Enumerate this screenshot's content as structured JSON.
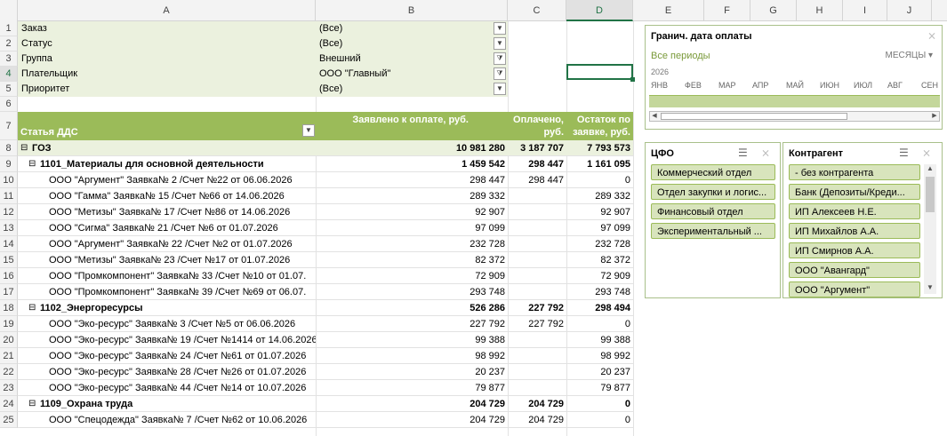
{
  "columns": [
    "A",
    "B",
    "C",
    "D",
    "E",
    "F",
    "G",
    "H",
    "I",
    "J"
  ],
  "rows_numbers": [
    "1",
    "2",
    "3",
    "4",
    "5",
    "6",
    "7",
    "8",
    "9",
    "10",
    "11",
    "12",
    "13",
    "14",
    "15",
    "16",
    "17",
    "18",
    "19",
    "20",
    "21",
    "22",
    "23",
    "24",
    "25"
  ],
  "filters": [
    {
      "label": "Заказ",
      "value": "(Все)",
      "icon": "dropdown"
    },
    {
      "label": "Статус",
      "value": "(Все)",
      "icon": "dropdown"
    },
    {
      "label": "Группа",
      "value": "Внешний",
      "icon": "filter"
    },
    {
      "label": "Плательщик",
      "value": "ООО \"Главный\"",
      "icon": "filter"
    },
    {
      "label": "Приоритет",
      "value": "(Все)",
      "icon": "dropdown"
    }
  ],
  "header": {
    "col_a": "Статья ДДС",
    "col_b": "Заявлено к оплате, руб.",
    "col_c1": "Оплачено,",
    "col_c2": "руб.",
    "col_d1": "Остаток по",
    "col_d2": "заявке, руб."
  },
  "rows": [
    {
      "n": "8",
      "label": "ГОЗ",
      "b": "10 981 280",
      "c": "3 187 707",
      "d": "7 793 573",
      "level": 0
    },
    {
      "n": "9",
      "label": "1101_Материалы для основной деятельности",
      "b": "1 459 542",
      "c": "298 447",
      "d": "1 161 095",
      "level": 1
    },
    {
      "n": "10",
      "label": "ООО \"Аргумент\" Заявка№ 2 /Счет №22 от 06.06.2026",
      "b": "298 447",
      "c": "298 447",
      "d": "0",
      "level": 2
    },
    {
      "n": "11",
      "label": "ООО \"Гамма\" Заявка№ 15 /Счет №66 от 14.06.2026",
      "b": "289 332",
      "c": "",
      "d": "289 332",
      "level": 2
    },
    {
      "n": "12",
      "label": "ООО \"Метизы\" Заявка№ 17 /Счет №86 от 14.06.2026",
      "b": "92 907",
      "c": "",
      "d": "92 907",
      "level": 2
    },
    {
      "n": "13",
      "label": "ООО \"Сигма\" Заявка№ 21 /Счет №6 от 01.07.2026",
      "b": "97 099",
      "c": "",
      "d": "97 099",
      "level": 2
    },
    {
      "n": "14",
      "label": "ООО \"Аргумент\" Заявка№ 22 /Счет №2 от 01.07.2026",
      "b": "232 728",
      "c": "",
      "d": "232 728",
      "level": 2
    },
    {
      "n": "15",
      "label": "ООО \"Метизы\" Заявка№ 23 /Счет №17 от 01.07.2026",
      "b": "82 372",
      "c": "",
      "d": "82 372",
      "level": 2
    },
    {
      "n": "16",
      "label": "ООО \"Промкомпонент\" Заявка№ 33 /Счет №10 от 01.07.",
      "b": "72 909",
      "c": "",
      "d": "72 909",
      "level": 2
    },
    {
      "n": "17",
      "label": "ООО \"Промкомпонент\" Заявка№ 39 /Счет №69 от 06.07.",
      "b": "293 748",
      "c": "",
      "d": "293 748",
      "level": 2
    },
    {
      "n": "18",
      "label": "1102_Энергоресурсы",
      "b": "526 286",
      "c": "227 792",
      "d": "298 494",
      "level": 1
    },
    {
      "n": "19",
      "label": "ООО \"Эко-ресурс\" Заявка№ 3 /Счет №5 от 06.06.2026",
      "b": "227 792",
      "c": "227 792",
      "d": "0",
      "level": 2
    },
    {
      "n": "20",
      "label": "ООО \"Эко-ресурс\" Заявка№ 19 /Счет №1414 от 14.06.2026",
      "b": "99 388",
      "c": "",
      "d": "99 388",
      "level": 2
    },
    {
      "n": "21",
      "label": "ООО \"Эко-ресурс\" Заявка№ 24 /Счет №61 от 01.07.2026",
      "b": "98 992",
      "c": "",
      "d": "98 992",
      "level": 2
    },
    {
      "n": "22",
      "label": "ООО \"Эко-ресурс\" Заявка№ 28 /Счет №26 от 01.07.2026",
      "b": "20 237",
      "c": "",
      "d": "20 237",
      "level": 2
    },
    {
      "n": "23",
      "label": "ООО \"Эко-ресурс\" Заявка№ 44 /Счет №14 от 10.07.2026",
      "b": "79 877",
      "c": "",
      "d": "79 877",
      "level": 2
    },
    {
      "n": "24",
      "label": "1109_Охрана труда",
      "b": "204 729",
      "c": "204 729",
      "d": "0",
      "level": 1
    },
    {
      "n": "25",
      "label": "ООО \"Спецодежда\" Заявка№ 7 /Счет №62 от 10.06.2026",
      "b": "204 729",
      "c": "204 729",
      "d": "0",
      "level": 2
    }
  ],
  "timeline": {
    "title": "Гранич. дата оплаты",
    "all_periods": "Все периоды",
    "unit": "МЕСЯЦЫ",
    "year": "2026",
    "months": [
      "ЯНВ",
      "ФЕВ",
      "МАР",
      "АПР",
      "МАЙ",
      "ИЮН",
      "ИЮЛ",
      "АВГ",
      "СЕН"
    ]
  },
  "slicer_cfo": {
    "title": "ЦФО",
    "items": [
      "Коммерческий отдел",
      "Отдел закупки и логис...",
      "Финансовый отдел",
      "Экспериментальный ..."
    ]
  },
  "slicer_contr": {
    "title": "Контрагент",
    "items": [
      " - без контрагента",
      "Банк (Депозиты/Креди...",
      "ИП Алексеев Н.Е.",
      "ИП Михайлов А.А.",
      "ИП Смирнов А.А.",
      "ООО \"Авангард\"",
      "ООО \"Аргумент\""
    ]
  },
  "colors": {
    "accent": "#9bbb59",
    "light": "#ebf1de",
    "chip": "#d8e4bc",
    "select": "#217346"
  }
}
